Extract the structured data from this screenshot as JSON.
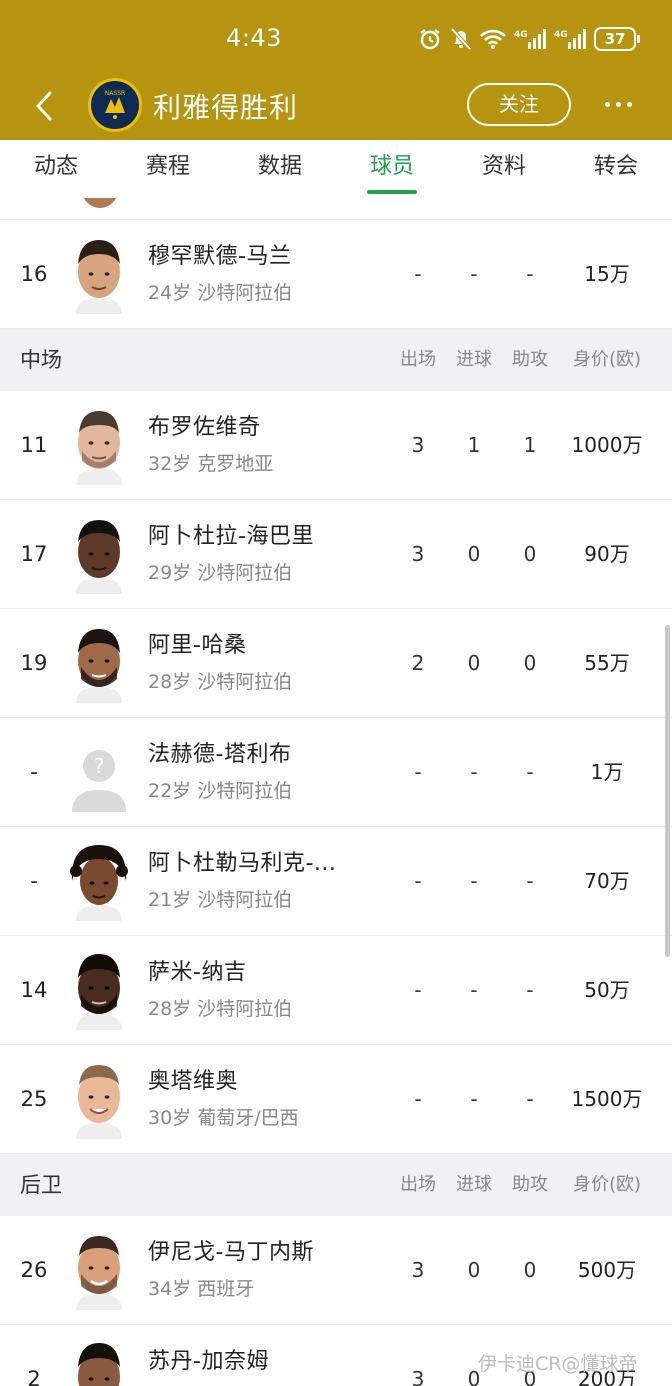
{
  "status_bar": {
    "time": "4:43",
    "battery": "37",
    "network_1": "4G",
    "network_2": "4G"
  },
  "header": {
    "title": "利雅得胜利",
    "logo_text": "NASSR",
    "follow_label": "关注"
  },
  "tabs": [
    {
      "label": "动态"
    },
    {
      "label": "赛程"
    },
    {
      "label": "数据"
    },
    {
      "label": "球员"
    },
    {
      "label": "资料"
    },
    {
      "label": "转会"
    }
  ],
  "active_tab": "球员",
  "rows_top": [
    {
      "number": "16",
      "name": "穆罕默德-马兰",
      "meta": "24岁 沙特阿拉伯",
      "apps": "-",
      "goals": "-",
      "assists": "-",
      "value": "15万",
      "avatar": "player-photo"
    }
  ],
  "midfield": {
    "title": "中场",
    "columns": [
      "出场",
      "进球",
      "助攻",
      "身价(欧)"
    ],
    "players": [
      {
        "number": "11",
        "name": "布罗佐维奇",
        "meta": "32岁 克罗地亚",
        "apps": "3",
        "goals": "1",
        "assists": "1",
        "value": "1000万",
        "avatar": "player-photo"
      },
      {
        "number": "17",
        "name": "阿卜杜拉-海巴里",
        "meta": "29岁 沙特阿拉伯",
        "apps": "3",
        "goals": "0",
        "assists": "0",
        "value": "90万",
        "avatar": "player-photo"
      },
      {
        "number": "19",
        "name": "阿里-哈桑",
        "meta": "28岁 沙特阿拉伯",
        "apps": "2",
        "goals": "0",
        "assists": "0",
        "value": "55万",
        "avatar": "player-photo"
      },
      {
        "number": "-",
        "name": "法赫德-塔利布",
        "meta": "22岁 沙特阿拉伯",
        "apps": "-",
        "goals": "-",
        "assists": "-",
        "value": "1万",
        "avatar": "placeholder-avatar"
      },
      {
        "number": "-",
        "name": "阿卜杜勒马利克-...",
        "meta": "21岁 沙特阿拉伯",
        "apps": "-",
        "goals": "-",
        "assists": "-",
        "value": "70万",
        "avatar": "player-photo"
      },
      {
        "number": "14",
        "name": "萨米-纳吉",
        "meta": "28岁 沙特阿拉伯",
        "apps": "-",
        "goals": "-",
        "assists": "-",
        "value": "50万",
        "avatar": "player-photo"
      },
      {
        "number": "25",
        "name": "奥塔维奥",
        "meta": "30岁 葡萄牙/巴西",
        "apps": "-",
        "goals": "-",
        "assists": "-",
        "value": "1500万",
        "avatar": "player-photo"
      }
    ]
  },
  "defense": {
    "title": "后卫",
    "columns": [
      "出场",
      "进球",
      "助攻",
      "身价(欧)"
    ],
    "players": [
      {
        "number": "26",
        "name": "伊尼戈-马丁内斯",
        "meta": "34岁 西班牙",
        "apps": "3",
        "goals": "0",
        "assists": "0",
        "value": "500万",
        "avatar": "player-photo"
      },
      {
        "number": "2",
        "name": "苏丹-加奈姆",
        "meta": "",
        "apps": "3",
        "goals": "0",
        "assists": "0",
        "value": "200万",
        "avatar": "player-photo"
      }
    ]
  },
  "watermark": "伊卡迪CR@懂球帝",
  "colors": {
    "header_bg": "#b79410",
    "active_tab": "#1fa34a",
    "section_bg": "#f0f1f3"
  }
}
